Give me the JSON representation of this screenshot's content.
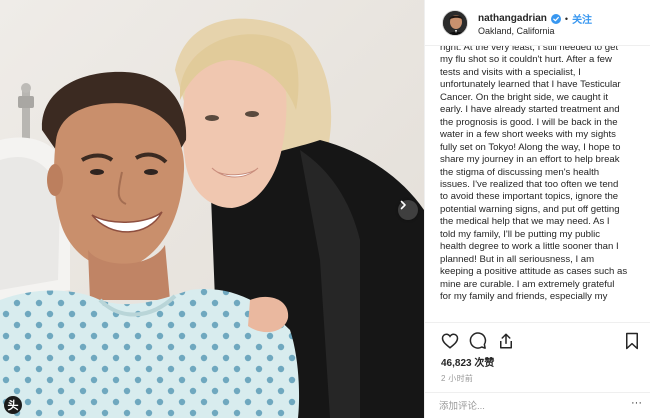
{
  "post": {
    "username": "nathangadrian",
    "separator": "•",
    "follow_label": "关注",
    "location": "Oakland, California",
    "caption_lines": [
      "right. At the very least, I still needed to get",
      "my flu shot so it couldn't hurt. After a few",
      "tests and visits with a specialist, I",
      "unfortunately learned that I have Testicular",
      "Cancer. On the bright side, we caught it",
      "early. I have already started treatment and",
      "the prognosis is good. I will be back in the",
      "water in a few short weeks with my sights",
      "fully set on Tokyo! Along the way, I hope to",
      "share my journey in an effort to help break",
      "the stigma of discussing men's health",
      "issues. I've realized that too often we tend",
      "to avoid these important topics, ignore the",
      "potential warning signs, and put off getting",
      "the medical help that we may need. As I",
      "told my family, I'll be putting my public",
      "health degree to work a little sooner than I",
      "planned! But in all seriousness, I am",
      "keeping a positive attitude as cases such as",
      "mine are curable. I am extremely grateful",
      "for my family and friends, especially my"
    ],
    "likes_text": "46,823 次赞",
    "time_text": "2 小时前",
    "comment_placeholder": "添加评论...",
    "comment_more": "···",
    "photo_badge": "头"
  },
  "icons": {
    "like": "heart-icon",
    "comment": "comment-bubble-icon",
    "share": "share-icon",
    "save": "bookmark-icon",
    "next": "chevron-right-icon",
    "verified": "verified-badge-icon"
  },
  "colors": {
    "link_blue": "#3897f0",
    "verified_blue": "#3897f0",
    "text": "#262626",
    "muted": "#999999",
    "divider": "#efefef"
  }
}
